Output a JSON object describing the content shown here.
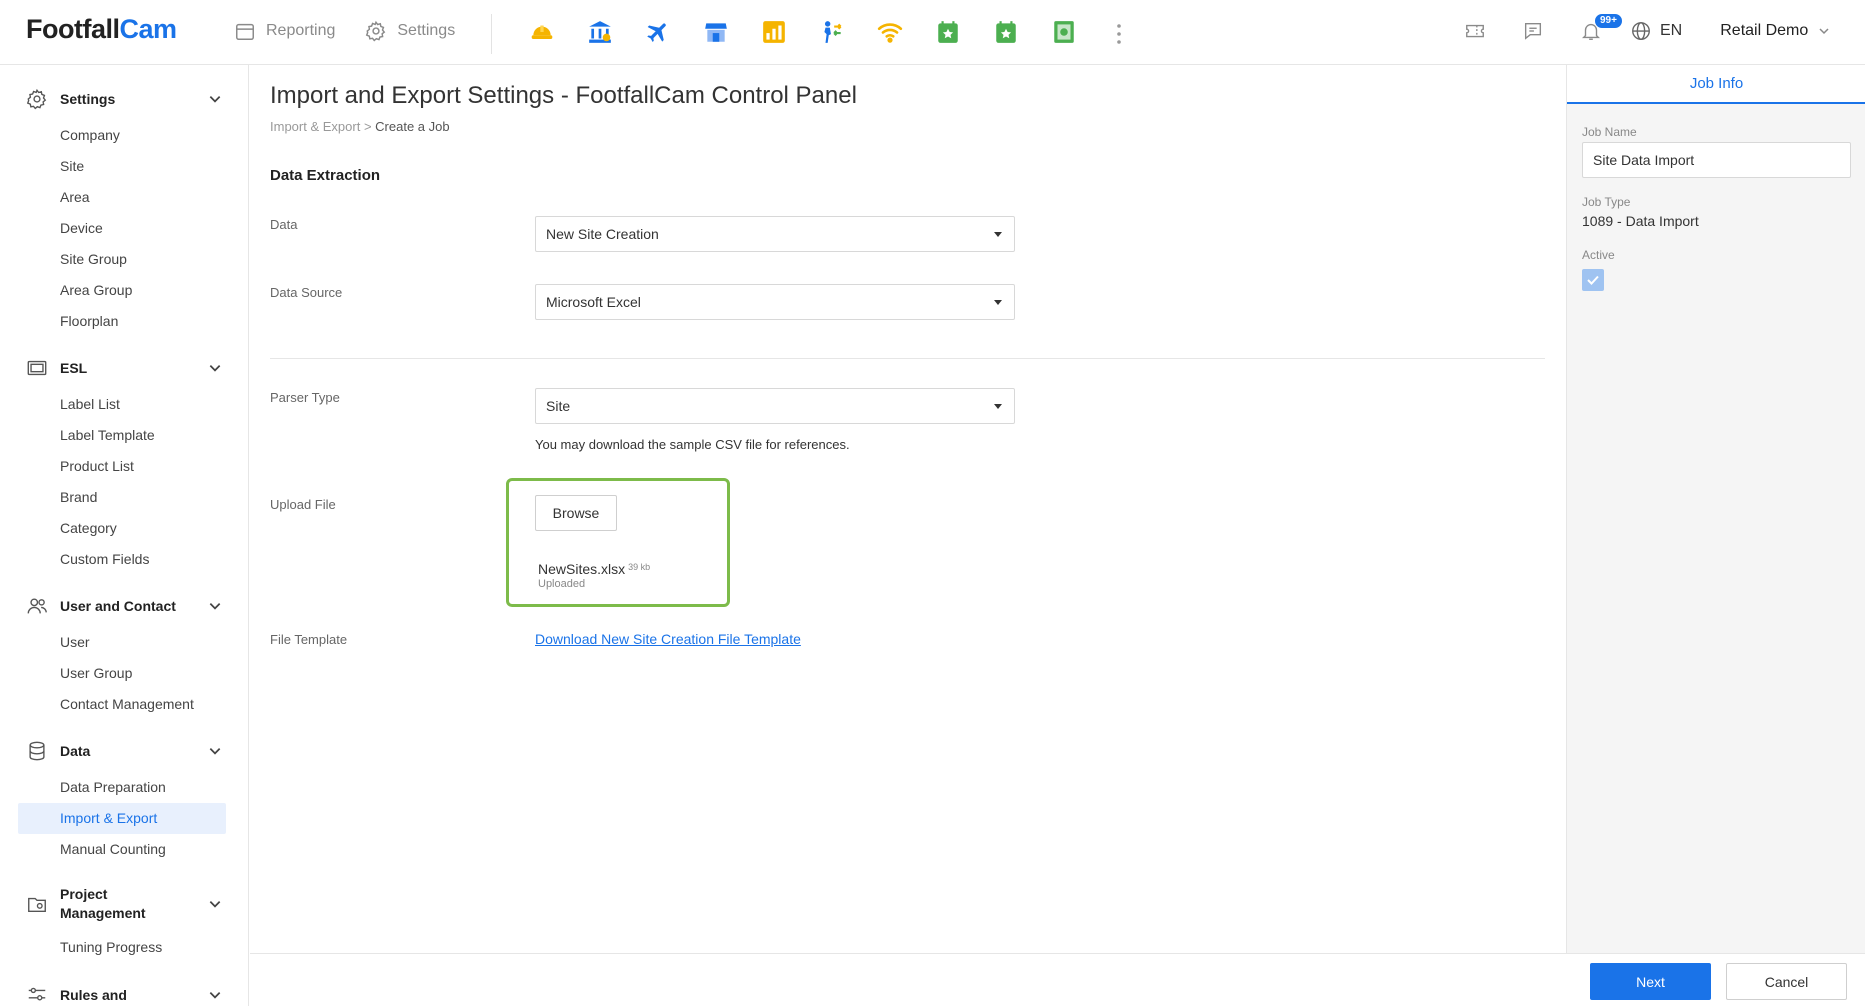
{
  "header": {
    "logo_left": "Footfall",
    "logo_right": "Cam",
    "nav": [
      {
        "label": "Reporting",
        "icon": "calendar-icon"
      },
      {
        "label": "Settings",
        "icon": "gear-icon"
      }
    ],
    "apps": [
      {
        "icon": "hardhat-icon",
        "color": "#f5b400"
      },
      {
        "icon": "bank-icon",
        "color": "#1a73e8"
      },
      {
        "icon": "airplane-icon",
        "color": "#1a73e8"
      },
      {
        "icon": "store-icon",
        "color": "#1a73e8"
      },
      {
        "icon": "chart-icon",
        "color": "#f5b400"
      },
      {
        "icon": "people-transfer-icon",
        "color": "#1a73e8"
      },
      {
        "icon": "wifi-icon",
        "color": "#f5b400"
      },
      {
        "icon": "calendar-star-icon",
        "color": "#4caf50"
      },
      {
        "icon": "calendar-star-icon",
        "color": "#4caf50"
      },
      {
        "icon": "money-icon",
        "color": "#4caf50"
      }
    ],
    "notification_badge": "99+",
    "language": "EN",
    "user": "Retail Demo"
  },
  "sidebar": {
    "sections": [
      {
        "title": "Settings",
        "icon": "gear-icon",
        "items": [
          "Company",
          "Site",
          "Area",
          "Device",
          "Site Group",
          "Area Group",
          "Floorplan"
        ]
      },
      {
        "title": "ESL",
        "icon": "esl-label-icon",
        "items": [
          "Label List",
          "Label Template",
          "Product List",
          "Brand",
          "Category",
          "Custom Fields"
        ]
      },
      {
        "title": "User and Contact",
        "icon": "users-icon",
        "items": [
          "User",
          "User Group",
          "Contact Management"
        ]
      },
      {
        "title": "Data",
        "icon": "database-icon",
        "items": [
          "Data Preparation",
          "Import & Export",
          "Manual Counting"
        ]
      },
      {
        "title_line1": "Project",
        "title_line2": "Management",
        "icon": "project-icon",
        "items": [
          "Tuning Progress"
        ]
      },
      {
        "title": "Rules and",
        "icon": "rules-icon",
        "items": []
      }
    ],
    "active_item": "Import & Export"
  },
  "main": {
    "title": "Import and Export Settings - FootfallCam Control Panel",
    "breadcrumb": {
      "parent": "Import & Export",
      "separator": ">",
      "current": "Create a Job"
    },
    "section_title": "Data Extraction",
    "fields": {
      "data": {
        "label": "Data",
        "value": "New Site Creation"
      },
      "data_source": {
        "label": "Data Source",
        "value": "Microsoft Excel"
      },
      "parser_type": {
        "label": "Parser Type",
        "value": "Site"
      },
      "hint": "You may download the sample CSV file for references.",
      "upload": {
        "label": "Upload File",
        "button": "Browse",
        "file_name": "NewSites.xlsx",
        "file_size": "39 kb",
        "status": "Uploaded"
      },
      "template": {
        "label": "File Template",
        "link": "Download New Site Creation File Template"
      }
    }
  },
  "panel": {
    "tab": "Job Info",
    "job_name_label": "Job Name",
    "job_name_value": "Site Data Import",
    "job_type_label": "Job Type",
    "job_type_value": "1089 - Data Import",
    "active_label": "Active",
    "active_checked": true
  },
  "footer": {
    "next": "Next",
    "cancel": "Cancel"
  },
  "colors": {
    "accent": "#1a73e8",
    "upload_highlight": "#7dbb4a"
  }
}
